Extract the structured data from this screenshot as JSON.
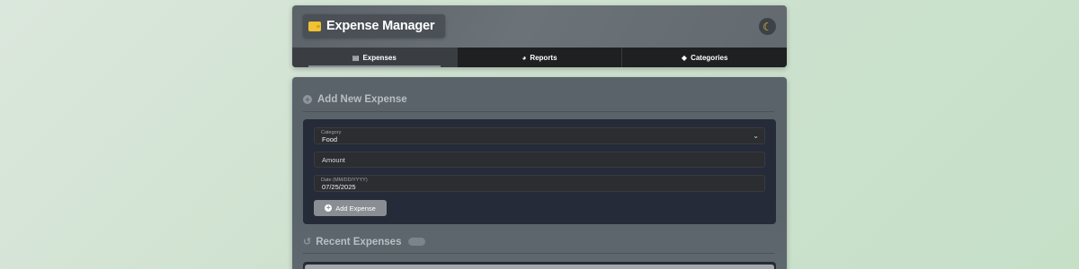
{
  "header": {
    "title": "Expense Manager",
    "logo_icon": "wallet-icon",
    "theme_toggle_icon": "moon-icon"
  },
  "tabs": [
    {
      "label": "Expenses",
      "icon": "receipt-icon",
      "active": true
    },
    {
      "label": "Reports",
      "icon": "pie-chart-icon",
      "active": false
    },
    {
      "label": "Categories",
      "icon": "tags-icon",
      "active": false
    }
  ],
  "add_expense": {
    "heading": "Add New Expense",
    "category": {
      "label": "Category",
      "value": "Food"
    },
    "amount": {
      "placeholder": "Amount",
      "value": ""
    },
    "date": {
      "label": "Date (MM/DD/YYYY)",
      "value": "07/25/2025"
    },
    "submit_label": "Add Expense"
  },
  "recent": {
    "heading": "Recent Expenses",
    "count": ""
  },
  "colors": {
    "accent": "#f1c232",
    "form_panel": "#252b38",
    "card": "#5a6369"
  }
}
